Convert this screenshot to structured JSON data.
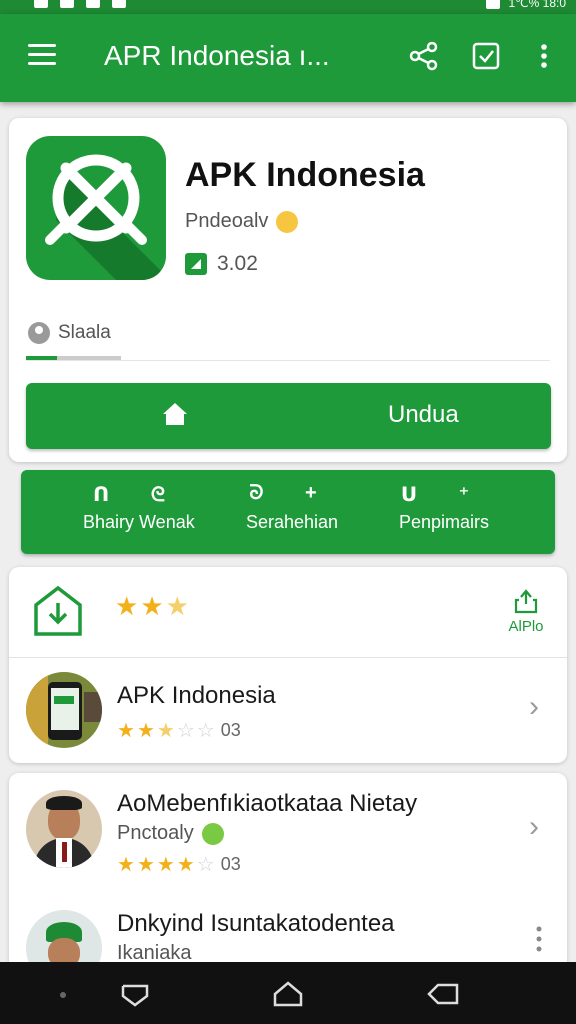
{
  "status_bar": {
    "right_text": "1℃% 18:0"
  },
  "app_bar": {
    "title": "APR Indonesia ı...",
    "menu_icon": "hamburger-menu-icon",
    "share_icon": "share-icon",
    "checkbox_icon": "check-box-icon",
    "more_icon": "more-vert-icon"
  },
  "app": {
    "name": "APK Indonesia",
    "developer": "Pndeoalv",
    "version": "3.02",
    "status_label": "Slaala",
    "progress": 0.33,
    "install_label": "Undua"
  },
  "actions": [
    {
      "label": "Bhairy Wenak",
      "icon": "ᑎ ᘓ"
    },
    {
      "label": "Serahehian",
      "icon": "ᘐ +"
    },
    {
      "label": "Penpimairs",
      "icon": "ᑌ ⁺"
    }
  ],
  "rating_card": {
    "rating": 2.5,
    "share_label": "AlPlo"
  },
  "list": [
    {
      "title": "APK Indonesia",
      "rating": "3",
      "rating_text": "03"
    },
    {
      "title": "AoMebenfıkiaotkataa Nietay",
      "subtitle": "Pnctoaly",
      "rating": "4",
      "rating_text": "03"
    },
    {
      "title": "Dnkyind Isuntakatodentea",
      "subtitle": "Ikaniaka"
    }
  ],
  "colors": {
    "primary": "#1e9a3a",
    "star": "#f2b11a"
  }
}
